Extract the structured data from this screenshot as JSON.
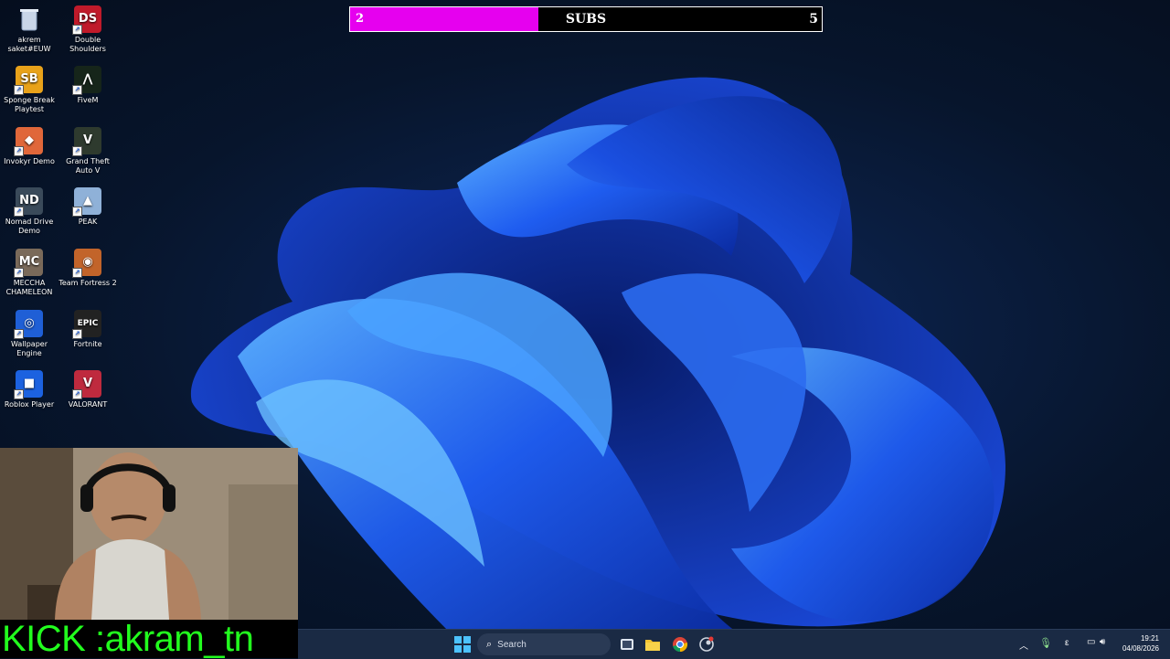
{
  "desktop_icons": [
    {
      "label": "akrem saket#EUW",
      "icon": "recycle-bin-icon"
    },
    {
      "label": "Double Shoulders",
      "icon": "double-shoulders-icon",
      "glyph": "DS",
      "color": "#c01a2a"
    },
    {
      "label": "Sponge Break Playtest",
      "icon": "sponge-break-icon",
      "glyph": "SB",
      "color": "#e8a21a"
    },
    {
      "label": "FiveM",
      "icon": "fivem-icon",
      "glyph": "⋀",
      "color": "#16251a"
    },
    {
      "label": "Invokyr Demo",
      "icon": "invokyr-icon",
      "glyph": "◆",
      "color": "#e0673a"
    },
    {
      "label": "Grand Theft Auto V",
      "icon": "gta-v-icon",
      "glyph": "V",
      "color": "#2e3a2e"
    },
    {
      "label": "Nomad Drive Demo",
      "icon": "nomad-drive-icon",
      "glyph": "ND",
      "color": "#3a4a5a"
    },
    {
      "label": "PEAK",
      "icon": "peak-icon",
      "glyph": "▲",
      "color": "#8fb1d8"
    },
    {
      "label": "MECCHA CHAMELEON",
      "icon": "meccha-chameleon-icon",
      "glyph": "MC",
      "color": "#7a6a5a"
    },
    {
      "label": "Team Fortress 2",
      "icon": "tf2-icon",
      "glyph": "◉",
      "color": "#c2642a"
    },
    {
      "label": "Wallpaper Engine",
      "icon": "wallpaper-engine-icon",
      "glyph": "◎",
      "color": "#1f5fd6"
    },
    {
      "label": "Fortnite",
      "icon": "epic-games-icon",
      "glyph": "EPIC",
      "color": "#222222"
    },
    {
      "label": "Roblox Player",
      "icon": "roblox-icon",
      "glyph": "■",
      "color": "#1c62e0"
    },
    {
      "label": "VALORANT",
      "icon": "valorant-icon",
      "glyph": "V",
      "color": "#bf2a3e"
    }
  ],
  "subs_goal": {
    "title": "SUBS",
    "current": "2",
    "target": "5",
    "progress": 0.4,
    "fill_color": "#e600ef"
  },
  "overlay": {
    "kick_text": "KICK :akram_tn"
  },
  "taskbar": {
    "search_placeholder": "Search",
    "apps": [
      "windows-start-icon",
      "task-view-icon",
      "file-explorer-icon",
      "chrome-icon",
      "steam-icon"
    ],
    "tray": {
      "input_indicator": "ε"
    },
    "clock": {
      "time": "19:21",
      "date": "04/08/2026"
    }
  }
}
